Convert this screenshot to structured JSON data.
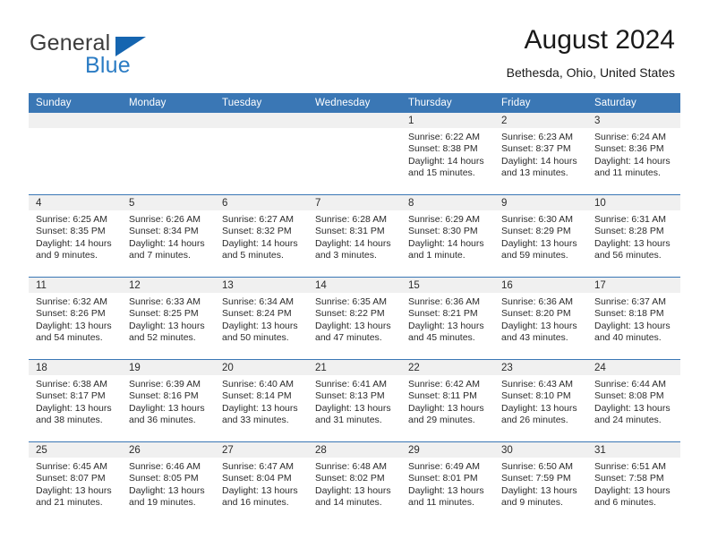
{
  "brand": {
    "name_part1": "General",
    "name_part2": "Blue",
    "triangle_color": "#1565b0",
    "blue_text_color": "#2b7cc4"
  },
  "header": {
    "title": "August 2024",
    "subtitle": "Bethesda, Ohio, United States"
  },
  "theme": {
    "header_blue": "#3a77b5",
    "daynum_band": "#f0f0f0",
    "text": "#2b2b2b"
  },
  "weekday_headers": [
    "Sunday",
    "Monday",
    "Tuesday",
    "Wednesday",
    "Thursday",
    "Friday",
    "Saturday"
  ],
  "labels": {
    "sunrise_prefix": "Sunrise: ",
    "sunset_prefix": "Sunset: ",
    "daylight_prefix": "Daylight: "
  },
  "weeks": [
    [
      {
        "day": "",
        "sunrise": "",
        "sunset": "",
        "daylight_line1": "",
        "daylight_line2": "",
        "empty": true
      },
      {
        "day": "",
        "sunrise": "",
        "sunset": "",
        "daylight_line1": "",
        "daylight_line2": "",
        "empty": true
      },
      {
        "day": "",
        "sunrise": "",
        "sunset": "",
        "daylight_line1": "",
        "daylight_line2": "",
        "empty": true
      },
      {
        "day": "",
        "sunrise": "",
        "sunset": "",
        "daylight_line1": "",
        "daylight_line2": "",
        "empty": true
      },
      {
        "day": "1",
        "sunrise": "Sunrise: 6:22 AM",
        "sunset": "Sunset: 8:38 PM",
        "daylight_line1": "Daylight: 14 hours",
        "daylight_line2": "and 15 minutes.",
        "empty": false
      },
      {
        "day": "2",
        "sunrise": "Sunrise: 6:23 AM",
        "sunset": "Sunset: 8:37 PM",
        "daylight_line1": "Daylight: 14 hours",
        "daylight_line2": "and 13 minutes.",
        "empty": false
      },
      {
        "day": "3",
        "sunrise": "Sunrise: 6:24 AM",
        "sunset": "Sunset: 8:36 PM",
        "daylight_line1": "Daylight: 14 hours",
        "daylight_line2": "and 11 minutes.",
        "empty": false
      }
    ],
    [
      {
        "day": "4",
        "sunrise": "Sunrise: 6:25 AM",
        "sunset": "Sunset: 8:35 PM",
        "daylight_line1": "Daylight: 14 hours",
        "daylight_line2": "and 9 minutes.",
        "empty": false
      },
      {
        "day": "5",
        "sunrise": "Sunrise: 6:26 AM",
        "sunset": "Sunset: 8:34 PM",
        "daylight_line1": "Daylight: 14 hours",
        "daylight_line2": "and 7 minutes.",
        "empty": false
      },
      {
        "day": "6",
        "sunrise": "Sunrise: 6:27 AM",
        "sunset": "Sunset: 8:32 PM",
        "daylight_line1": "Daylight: 14 hours",
        "daylight_line2": "and 5 minutes.",
        "empty": false
      },
      {
        "day": "7",
        "sunrise": "Sunrise: 6:28 AM",
        "sunset": "Sunset: 8:31 PM",
        "daylight_line1": "Daylight: 14 hours",
        "daylight_line2": "and 3 minutes.",
        "empty": false
      },
      {
        "day": "8",
        "sunrise": "Sunrise: 6:29 AM",
        "sunset": "Sunset: 8:30 PM",
        "daylight_line1": "Daylight: 14 hours",
        "daylight_line2": "and 1 minute.",
        "empty": false
      },
      {
        "day": "9",
        "sunrise": "Sunrise: 6:30 AM",
        "sunset": "Sunset: 8:29 PM",
        "daylight_line1": "Daylight: 13 hours",
        "daylight_line2": "and 59 minutes.",
        "empty": false
      },
      {
        "day": "10",
        "sunrise": "Sunrise: 6:31 AM",
        "sunset": "Sunset: 8:28 PM",
        "daylight_line1": "Daylight: 13 hours",
        "daylight_line2": "and 56 minutes.",
        "empty": false
      }
    ],
    [
      {
        "day": "11",
        "sunrise": "Sunrise: 6:32 AM",
        "sunset": "Sunset: 8:26 PM",
        "daylight_line1": "Daylight: 13 hours",
        "daylight_line2": "and 54 minutes.",
        "empty": false
      },
      {
        "day": "12",
        "sunrise": "Sunrise: 6:33 AM",
        "sunset": "Sunset: 8:25 PM",
        "daylight_line1": "Daylight: 13 hours",
        "daylight_line2": "and 52 minutes.",
        "empty": false
      },
      {
        "day": "13",
        "sunrise": "Sunrise: 6:34 AM",
        "sunset": "Sunset: 8:24 PM",
        "daylight_line1": "Daylight: 13 hours",
        "daylight_line2": "and 50 minutes.",
        "empty": false
      },
      {
        "day": "14",
        "sunrise": "Sunrise: 6:35 AM",
        "sunset": "Sunset: 8:22 PM",
        "daylight_line1": "Daylight: 13 hours",
        "daylight_line2": "and 47 minutes.",
        "empty": false
      },
      {
        "day": "15",
        "sunrise": "Sunrise: 6:36 AM",
        "sunset": "Sunset: 8:21 PM",
        "daylight_line1": "Daylight: 13 hours",
        "daylight_line2": "and 45 minutes.",
        "empty": false
      },
      {
        "day": "16",
        "sunrise": "Sunrise: 6:36 AM",
        "sunset": "Sunset: 8:20 PM",
        "daylight_line1": "Daylight: 13 hours",
        "daylight_line2": "and 43 minutes.",
        "empty": false
      },
      {
        "day": "17",
        "sunrise": "Sunrise: 6:37 AM",
        "sunset": "Sunset: 8:18 PM",
        "daylight_line1": "Daylight: 13 hours",
        "daylight_line2": "and 40 minutes.",
        "empty": false
      }
    ],
    [
      {
        "day": "18",
        "sunrise": "Sunrise: 6:38 AM",
        "sunset": "Sunset: 8:17 PM",
        "daylight_line1": "Daylight: 13 hours",
        "daylight_line2": "and 38 minutes.",
        "empty": false
      },
      {
        "day": "19",
        "sunrise": "Sunrise: 6:39 AM",
        "sunset": "Sunset: 8:16 PM",
        "daylight_line1": "Daylight: 13 hours",
        "daylight_line2": "and 36 minutes.",
        "empty": false
      },
      {
        "day": "20",
        "sunrise": "Sunrise: 6:40 AM",
        "sunset": "Sunset: 8:14 PM",
        "daylight_line1": "Daylight: 13 hours",
        "daylight_line2": "and 33 minutes.",
        "empty": false
      },
      {
        "day": "21",
        "sunrise": "Sunrise: 6:41 AM",
        "sunset": "Sunset: 8:13 PM",
        "daylight_line1": "Daylight: 13 hours",
        "daylight_line2": "and 31 minutes.",
        "empty": false
      },
      {
        "day": "22",
        "sunrise": "Sunrise: 6:42 AM",
        "sunset": "Sunset: 8:11 PM",
        "daylight_line1": "Daylight: 13 hours",
        "daylight_line2": "and 29 minutes.",
        "empty": false
      },
      {
        "day": "23",
        "sunrise": "Sunrise: 6:43 AM",
        "sunset": "Sunset: 8:10 PM",
        "daylight_line1": "Daylight: 13 hours",
        "daylight_line2": "and 26 minutes.",
        "empty": false
      },
      {
        "day": "24",
        "sunrise": "Sunrise: 6:44 AM",
        "sunset": "Sunset: 8:08 PM",
        "daylight_line1": "Daylight: 13 hours",
        "daylight_line2": "and 24 minutes.",
        "empty": false
      }
    ],
    [
      {
        "day": "25",
        "sunrise": "Sunrise: 6:45 AM",
        "sunset": "Sunset: 8:07 PM",
        "daylight_line1": "Daylight: 13 hours",
        "daylight_line2": "and 21 minutes.",
        "empty": false
      },
      {
        "day": "26",
        "sunrise": "Sunrise: 6:46 AM",
        "sunset": "Sunset: 8:05 PM",
        "daylight_line1": "Daylight: 13 hours",
        "daylight_line2": "and 19 minutes.",
        "empty": false
      },
      {
        "day": "27",
        "sunrise": "Sunrise: 6:47 AM",
        "sunset": "Sunset: 8:04 PM",
        "daylight_line1": "Daylight: 13 hours",
        "daylight_line2": "and 16 minutes.",
        "empty": false
      },
      {
        "day": "28",
        "sunrise": "Sunrise: 6:48 AM",
        "sunset": "Sunset: 8:02 PM",
        "daylight_line1": "Daylight: 13 hours",
        "daylight_line2": "and 14 minutes.",
        "empty": false
      },
      {
        "day": "29",
        "sunrise": "Sunrise: 6:49 AM",
        "sunset": "Sunset: 8:01 PM",
        "daylight_line1": "Daylight: 13 hours",
        "daylight_line2": "and 11 minutes.",
        "empty": false
      },
      {
        "day": "30",
        "sunrise": "Sunrise: 6:50 AM",
        "sunset": "Sunset: 7:59 PM",
        "daylight_line1": "Daylight: 13 hours",
        "daylight_line2": "and 9 minutes.",
        "empty": false
      },
      {
        "day": "31",
        "sunrise": "Sunrise: 6:51 AM",
        "sunset": "Sunset: 7:58 PM",
        "daylight_line1": "Daylight: 13 hours",
        "daylight_line2": "and 6 minutes.",
        "empty": false
      }
    ]
  ]
}
